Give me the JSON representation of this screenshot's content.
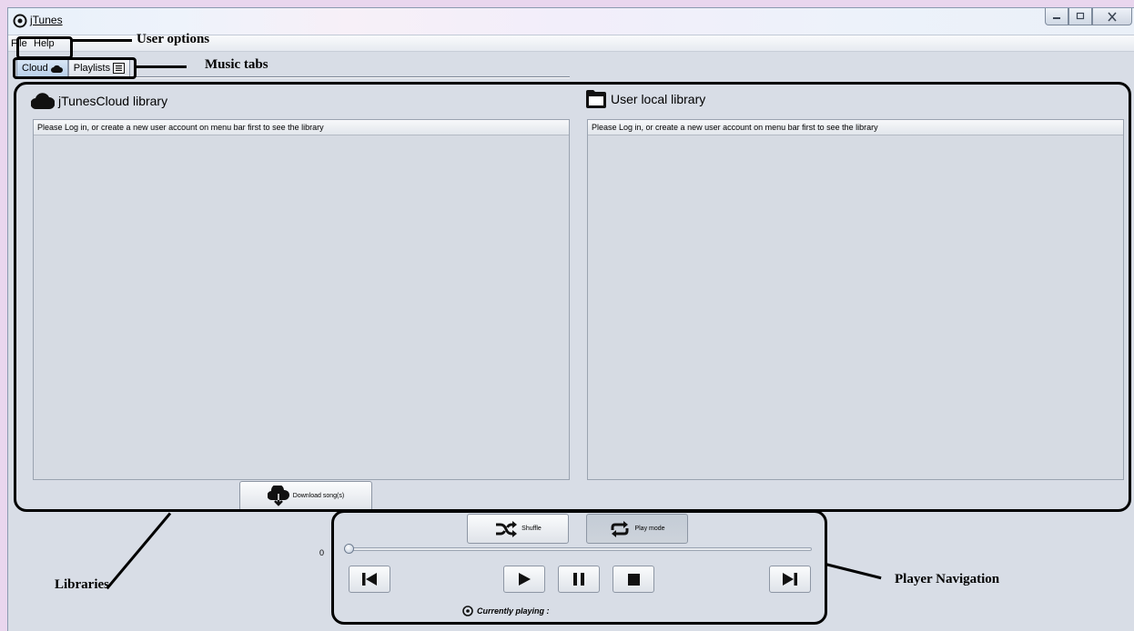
{
  "window": {
    "title": "jTunes",
    "controls": [
      "minimize",
      "maximize",
      "close"
    ]
  },
  "menu": {
    "items": [
      "File",
      "Help"
    ]
  },
  "tabs": [
    {
      "label": "Cloud",
      "icon": "cloud-icon",
      "selected": true
    },
    {
      "label": "Playlists",
      "icon": "list-icon",
      "selected": false
    }
  ],
  "cloud_library": {
    "title": "jTunesCloud library",
    "icon": "cloud-icon",
    "header": "Please Log in, or create a new user account on menu bar first to see the library"
  },
  "local_library": {
    "title": "User local library",
    "icon": "folder-icon",
    "header": "Please Log in, or create a new user account on menu bar first to see the library"
  },
  "download_button": {
    "label": "Download song(s)",
    "icon": "cloud-download-icon"
  },
  "player": {
    "shuffle_label": "Shuffle",
    "playmode_label": "Play mode",
    "time": "0",
    "progress": 0,
    "now_playing": "Currently playing :",
    "buttons": [
      "previous-icon",
      "play-icon",
      "pause-icon",
      "stop-icon",
      "next-icon"
    ]
  },
  "annotations": {
    "user_options": "User options",
    "music_tabs": "Music tabs",
    "libraries": "Libraries",
    "player_navigation": "Player Navigation"
  }
}
